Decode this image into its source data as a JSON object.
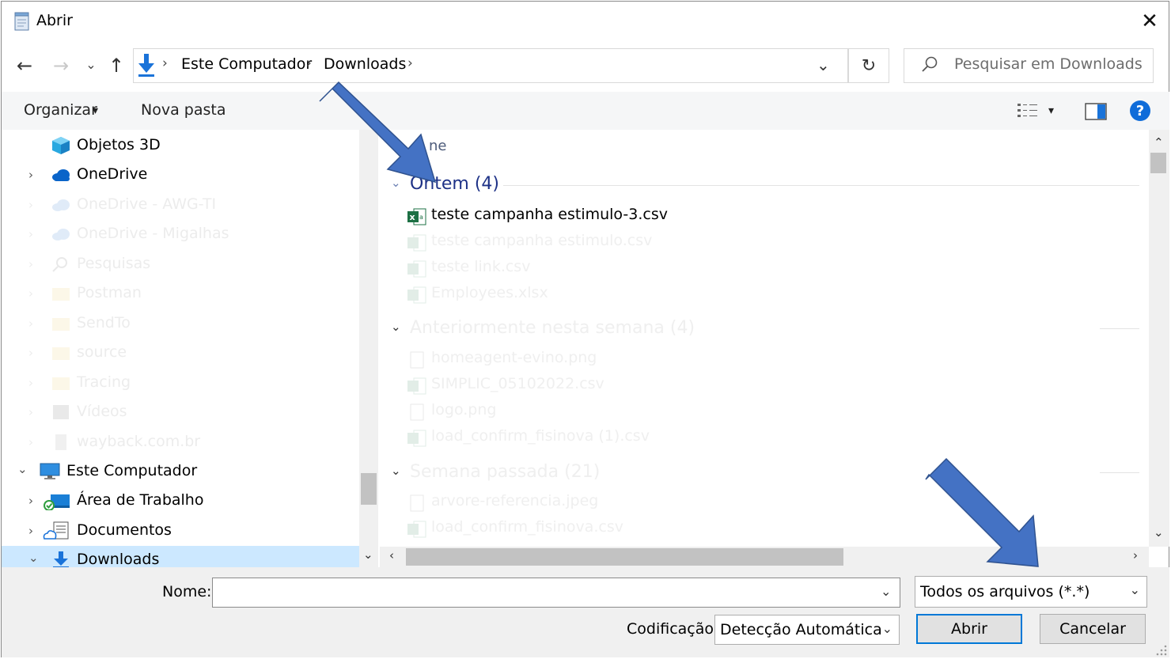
{
  "window": {
    "title": "Abrir",
    "close_glyph": "✕"
  },
  "nav": {
    "back_glyph": "←",
    "forward_glyph": "→",
    "recent_glyph": "⌄",
    "up_glyph": "↑",
    "breadcrumb": [
      "Este Computador",
      "Downloads"
    ],
    "sep_glyph": "›",
    "dropdown_glyph": "⌄",
    "refresh_glyph": "↻",
    "search_placeholder": "Pesquisar em Downloads"
  },
  "toolbar": {
    "organize_label": "Organizar",
    "organize_caret": "▾",
    "new_folder_label": "Nova pasta",
    "view_caret": "▾",
    "help_glyph": "?"
  },
  "sidebar": {
    "items": [
      {
        "label": "Objetos 3D",
        "icon": "cube-3d-icon"
      },
      {
        "label": "OneDrive",
        "icon": "cloud-icon"
      },
      {
        "label": "OneDrive - AWG-TI",
        "icon": "cloud-icon"
      },
      {
        "label": "OneDrive - Migalhas",
        "icon": "cloud-icon"
      },
      {
        "label": "Pesquisas",
        "icon": "search-folder-icon"
      },
      {
        "label": "Postman",
        "icon": "folder-icon"
      },
      {
        "label": "SendTo",
        "icon": "folder-icon"
      },
      {
        "label": "source",
        "icon": "folder-icon"
      },
      {
        "label": "Tracing",
        "icon": "folder-icon"
      },
      {
        "label": "Vídeos",
        "icon": "video-folder-icon"
      },
      {
        "label": "wayback.com.br",
        "icon": "file-icon"
      },
      {
        "label": "Este Computador",
        "icon": "computer-icon"
      },
      {
        "label": "Área de Trabalho",
        "icon": "desktop-icon"
      },
      {
        "label": "Documentos",
        "icon": "documents-icon"
      },
      {
        "label": "Downloads",
        "icon": "download-icon"
      }
    ],
    "chev_right": "›",
    "chev_down": "⌄"
  },
  "content": {
    "column_header_partial": "ne",
    "groups": [
      {
        "title": "Ontem (4)",
        "files": [
          "teste campanha estimulo-3.csv",
          "teste campanha estimulo.csv",
          "teste link.csv",
          "Employees.xlsx"
        ]
      },
      {
        "title": "Anteriormente nesta semana (4)",
        "files": [
          "homeagent-evino.png",
          "SIMPLIC_05102022.csv",
          "logo.png",
          "load_confirm_fisinova (1).csv"
        ]
      },
      {
        "title": "Semana passada (21)",
        "files": [
          "arvore-referencia.jpeg",
          "load_confirm_fisinova.csv"
        ]
      }
    ],
    "group_chev": "⌄"
  },
  "bottom": {
    "name_label": "Nome:",
    "name_value": "",
    "filetype_value": "Todos os arquivos  (*.*)",
    "encoding_label": "Codificação:",
    "encoding_value": "Detecção Automática",
    "open_label": "Abrir",
    "cancel_label": "Cancelar"
  },
  "colors": {
    "accent": "#0078d7",
    "group_header": "#1e3287",
    "arrow_annotation": "#4472c4",
    "selected_row": "#cce8ff",
    "excel_green": "#1d7044"
  }
}
